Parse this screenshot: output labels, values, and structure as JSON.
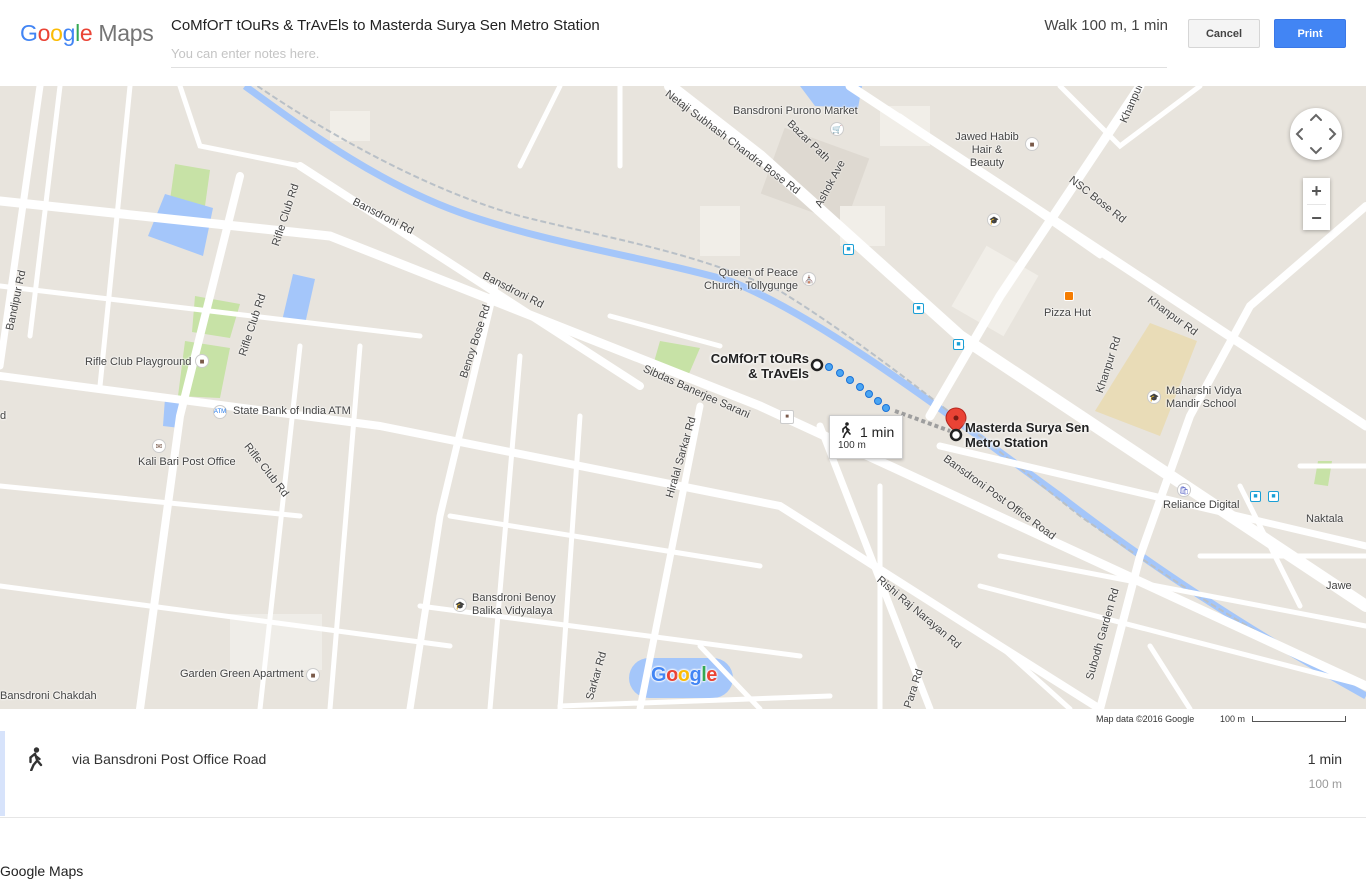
{
  "header": {
    "logo_part1": "Google",
    "logo_part2": "Maps",
    "trip_title": "CoMfOrT tOuRs & TrAvEls to Masterda Surya Sen Metro Station",
    "notes_placeholder": "You can enter notes here.",
    "summary": "Walk 100 m, 1 min",
    "cancel_label": "Cancel",
    "print_label": "Print"
  },
  "colors": {
    "accent": "#4285F4",
    "route": "#4285F4",
    "water": "#a4c6fa",
    "park": "#c7e2a6",
    "land": "#e8e4dd",
    "road": "#ffffff",
    "destination_pin": "#ea4335"
  },
  "map": {
    "roads": [
      "Netaji Subhash Chandra Bose Rd",
      "Bazar Path",
      "Ashok Ave",
      "NSC Bose Rd",
      "Khanpur Rd",
      "Bansdroni Rd",
      "Rifle Club Rd",
      "Bandipur Rd",
      "Benoy Bose Rd",
      "Sibdas Banerjee Sarani",
      "Hiralal Sarkar Rd",
      "Bansdroni Post Office Road",
      "Rishi Raj Narayan Rd",
      "Subodh Garden Rd",
      "Sarkar Rd",
      "Para Rd",
      "Khanpur",
      "Naktala",
      "Jawe"
    ],
    "places": [
      "Bansdroni Purono Market",
      "Jawed Habib Hair & Beauty",
      "Queen of Peace Church, Tollygunge",
      "Pizza Hut",
      "Rifle Club Playground",
      "State Bank of India ATM",
      "Kali Bari Post Office",
      "Maharshi Vidya Mandir School",
      "Reliance Digital",
      "Bansdroni Benoy Balika Vidyalaya",
      "Garden Green Apartment",
      "Bansdroni Chakdah",
      "d"
    ],
    "origin": "CoMfOrT tOuRs & TrAvEls",
    "destination": "Masterda Surya Sen Metro Station",
    "walk_time": "1 min",
    "walk_distance": "100 m",
    "zoom_in": "+",
    "zoom_out": "−",
    "watermark": "Google",
    "attribution": "Map data ©2016 Google",
    "scale_label": "100 m"
  },
  "step": {
    "via": "via Bansdroni Post Office Road",
    "time": "1 min",
    "distance": "100 m",
    "icon": "walking-person-icon"
  },
  "footer": {
    "text": "Google Maps"
  }
}
